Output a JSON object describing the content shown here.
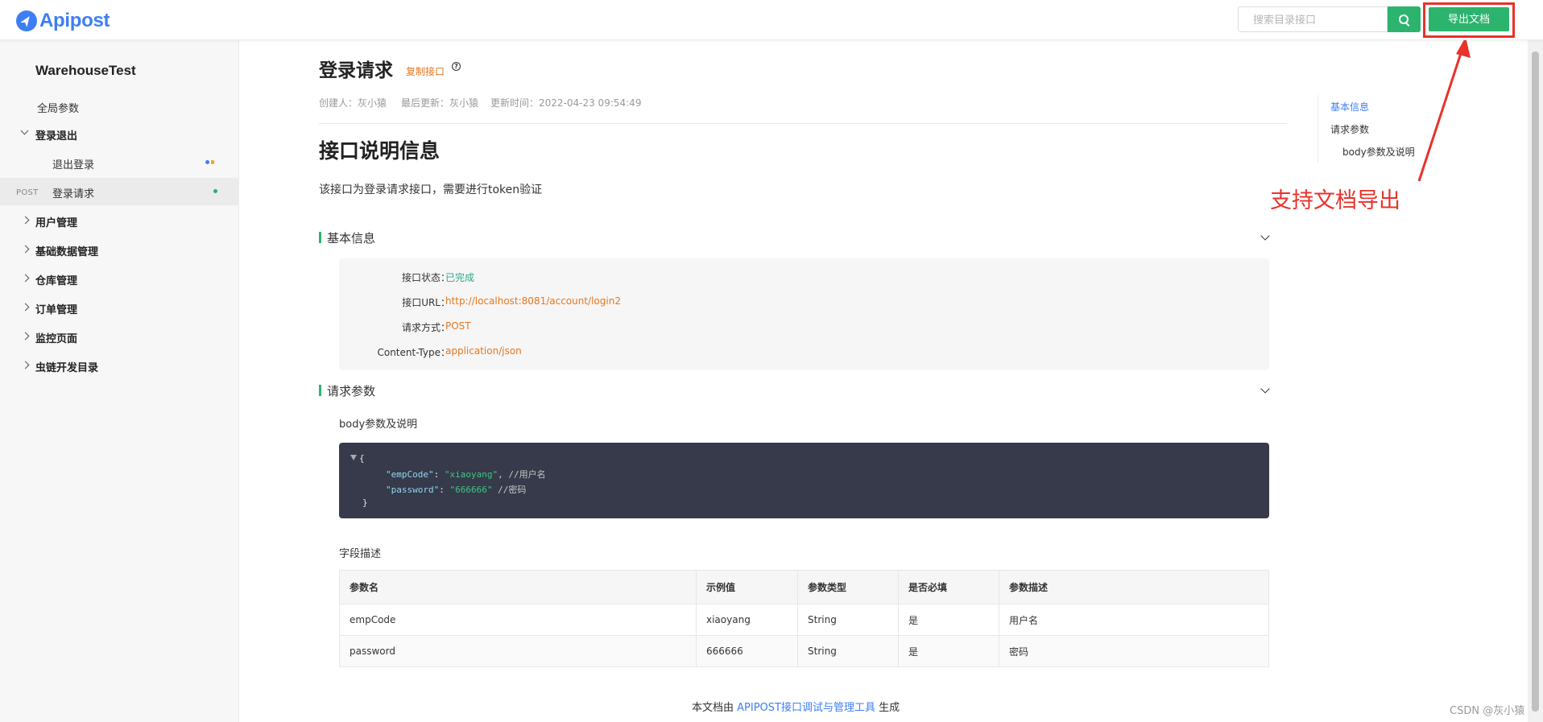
{
  "header": {
    "logo_text": "Apipost",
    "search_placeholder": "搜索目录接口",
    "export_label": "导出文档"
  },
  "sidebar": {
    "project_title": "WarehouseTest",
    "items": [
      {
        "label": "全局参数",
        "type": "item"
      },
      {
        "label": "登录退出",
        "type": "folder",
        "expanded": true
      },
      {
        "label": "退出登录",
        "type": "child"
      },
      {
        "label": "登录请求",
        "type": "child",
        "method": "POST",
        "active": true
      },
      {
        "label": "用户管理",
        "type": "folder"
      },
      {
        "label": "基础数据管理",
        "type": "folder"
      },
      {
        "label": "仓库管理",
        "type": "folder"
      },
      {
        "label": "订单管理",
        "type": "folder"
      },
      {
        "label": "监控页面",
        "type": "folder"
      },
      {
        "label": "虫链开发目录",
        "type": "folder"
      }
    ],
    "status_colors": {
      "blue": "#3d7ef5",
      "orange": "#f0a43a",
      "green": "#2aa98a"
    }
  },
  "doc": {
    "title": "登录请求",
    "copy_label": "复制接口",
    "help_symbol": "?",
    "creator": "创建人：灰小猿",
    "updater": "最后更新：灰小猿",
    "updated_time": "更新时间：2022-04-23 09:54:49",
    "section_title": "接口说明信息",
    "description": "该接口为登录请求接口，需要进行token验证",
    "basic_info": {
      "heading": "基本信息",
      "rows": [
        {
          "key": "接口状态：",
          "value": "已完成"
        },
        {
          "key": "接口URL：",
          "value": "http://localhost:8081/account/login2"
        },
        {
          "key": "请求方式：",
          "value": "POST"
        },
        {
          "key": "Content-Type：",
          "value": "application/json"
        }
      ]
    },
    "request_params": {
      "heading": "请求参数",
      "body_title": "body参数及说明",
      "code": {
        "open": "{",
        "line1_key": "\"empCode\"",
        "line1_val": "\"xiaoyang\"",
        "line1_comment": ", //用户名",
        "line2_key": "\"password\"",
        "line2_val": "\"666666\"",
        "line2_comment": " //密码",
        "close": "}"
      },
      "fields_title": "字段描述",
      "columns": [
        "参数名",
        "示例值",
        "参数类型",
        "是否必填",
        "参数描述"
      ],
      "rows": [
        [
          "empCode",
          "xiaoyang",
          "String",
          "是",
          "用户名"
        ],
        [
          "password",
          "666666",
          "String",
          "是",
          "密码"
        ]
      ]
    },
    "footer_prefix": "本文档由",
    "footer_link": "APIPOST接口调试与管理工具",
    "footer_suffix": "生成"
  },
  "toc": {
    "items": [
      "基本信息",
      "请求参数",
      "body参数及说明"
    ]
  },
  "annotation": {
    "text": "支持文档导出",
    "color": "#e8322b"
  },
  "watermark": "CSDN @灰小猿"
}
